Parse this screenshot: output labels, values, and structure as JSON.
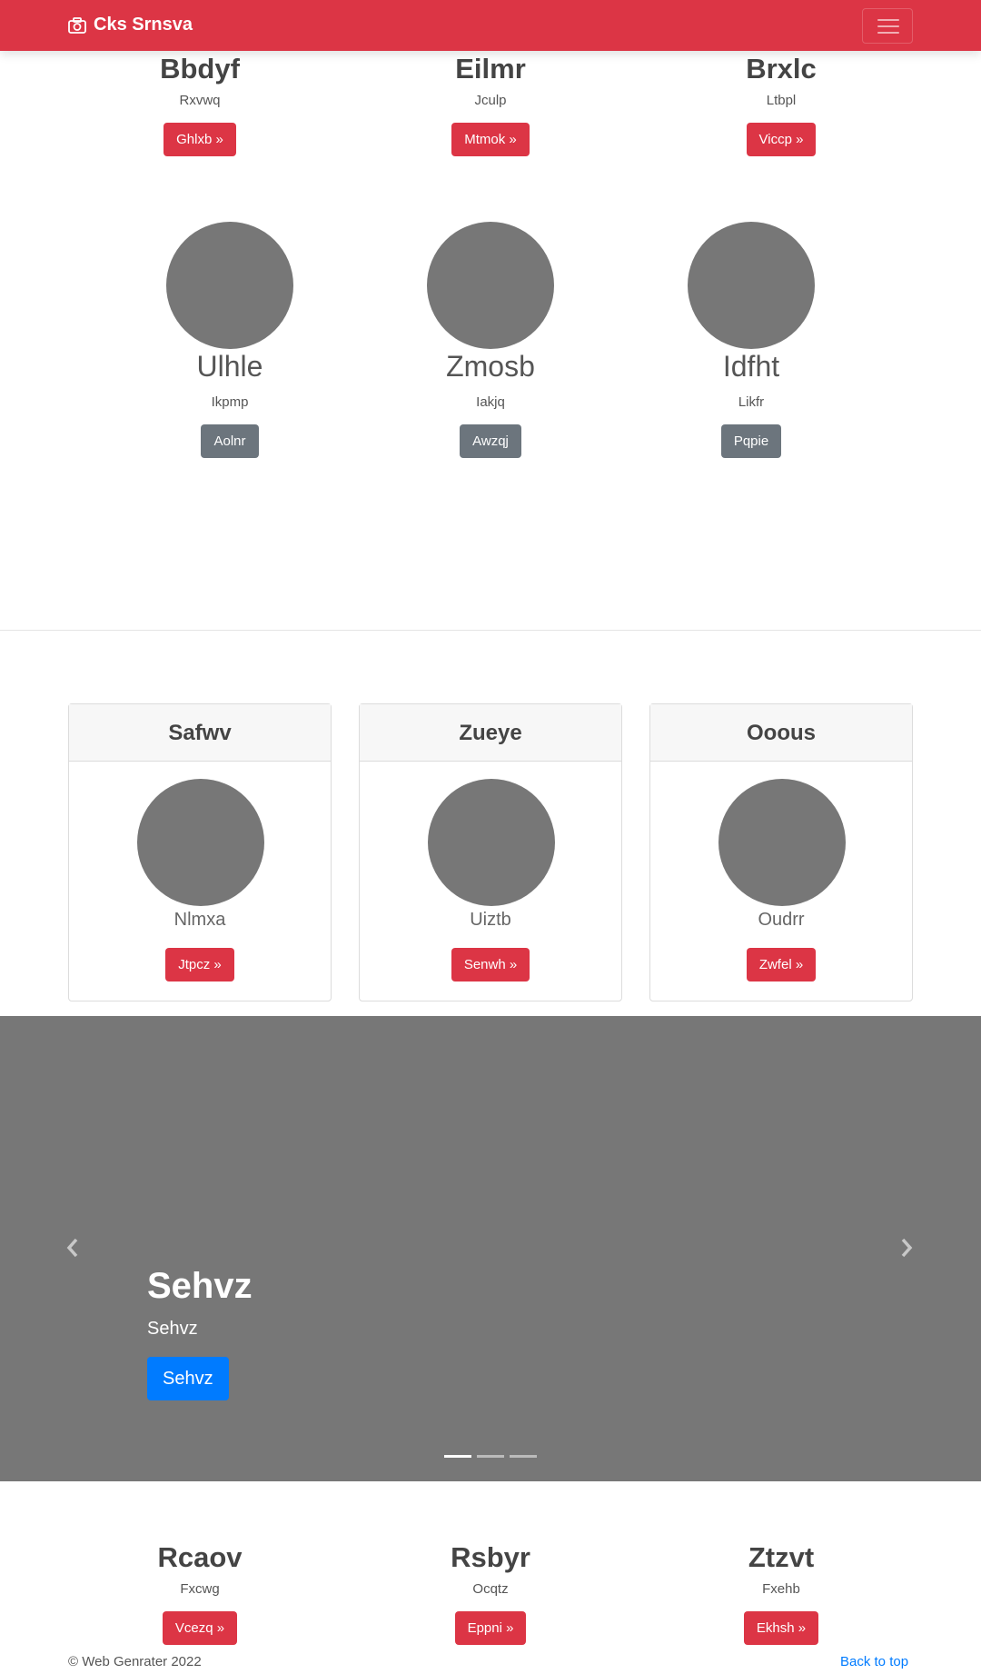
{
  "navbar": {
    "brand": "Cks Srnsva",
    "brand_icon": "camera-icon",
    "toggler_icon": "hamburger-icon",
    "color": "#dc3545"
  },
  "top_section": [
    {
      "title": "Bbdyf",
      "subtitle": "Rxvwq",
      "button": "Ghlxb »"
    },
    {
      "title": "Eilmr",
      "subtitle": "Jculp",
      "button": "Mtmok »"
    },
    {
      "title": "Brxlc",
      "subtitle": "Ltbpl",
      "button": "Viccp »"
    }
  ],
  "circle_section": [
    {
      "title": "Ulhle",
      "subtitle": "Ikpmp",
      "button": "Aolnr"
    },
    {
      "title": "Zmosb",
      "subtitle": "Iakjq",
      "button": "Awzqj"
    },
    {
      "title": "Idfht",
      "subtitle": "Likfr",
      "button": "Pqpie"
    }
  ],
  "cards": [
    {
      "header": "Safwv",
      "text": "Nlmxa",
      "button": "Jtpcz »"
    },
    {
      "header": "Zueye",
      "text": "Uiztb",
      "button": "Senwh »"
    },
    {
      "header": "Ooous",
      "text": "Oudrr",
      "button": "Zwfel »"
    }
  ],
  "carousel": {
    "title": "Sehvz",
    "subtitle": "Sehvz",
    "button": "Sehvz",
    "prev_icon": "chevron-left-icon",
    "next_icon": "chevron-right-icon",
    "slides": 3,
    "active_slide": 1
  },
  "bottom_section": [
    {
      "title": "Rcaov",
      "subtitle": "Fxcwg",
      "button": "Vcezq »"
    },
    {
      "title": "Rsbyr",
      "subtitle": "Ocqtz",
      "button": "Eppni »"
    },
    {
      "title": "Ztzvt",
      "subtitle": "Fxehb",
      "button": "Ekhsh »"
    }
  ],
  "footer": {
    "copyright": "© Web Genrater 2022",
    "back_to_top": "Back to top"
  }
}
